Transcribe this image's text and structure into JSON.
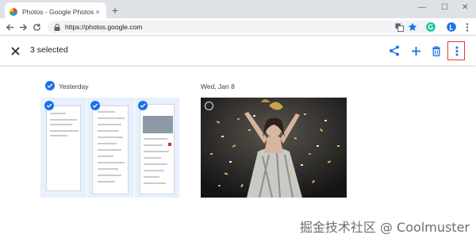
{
  "browser": {
    "tab_title": "Photos - Google Photos",
    "tab_close_icon": "×",
    "new_tab_icon": "+",
    "url": "https://photos.google.com",
    "window_controls": {
      "minimize": "—",
      "maximize": "☐",
      "close": "✕"
    }
  },
  "header": {
    "selected_count": "3 selected",
    "accent_color": "#1a73e8"
  },
  "sections": [
    {
      "date": "Yesterday"
    },
    {
      "date": "Wed, Jan 8"
    }
  ],
  "watermark": "掘金技术社区 @ Coolmuster"
}
